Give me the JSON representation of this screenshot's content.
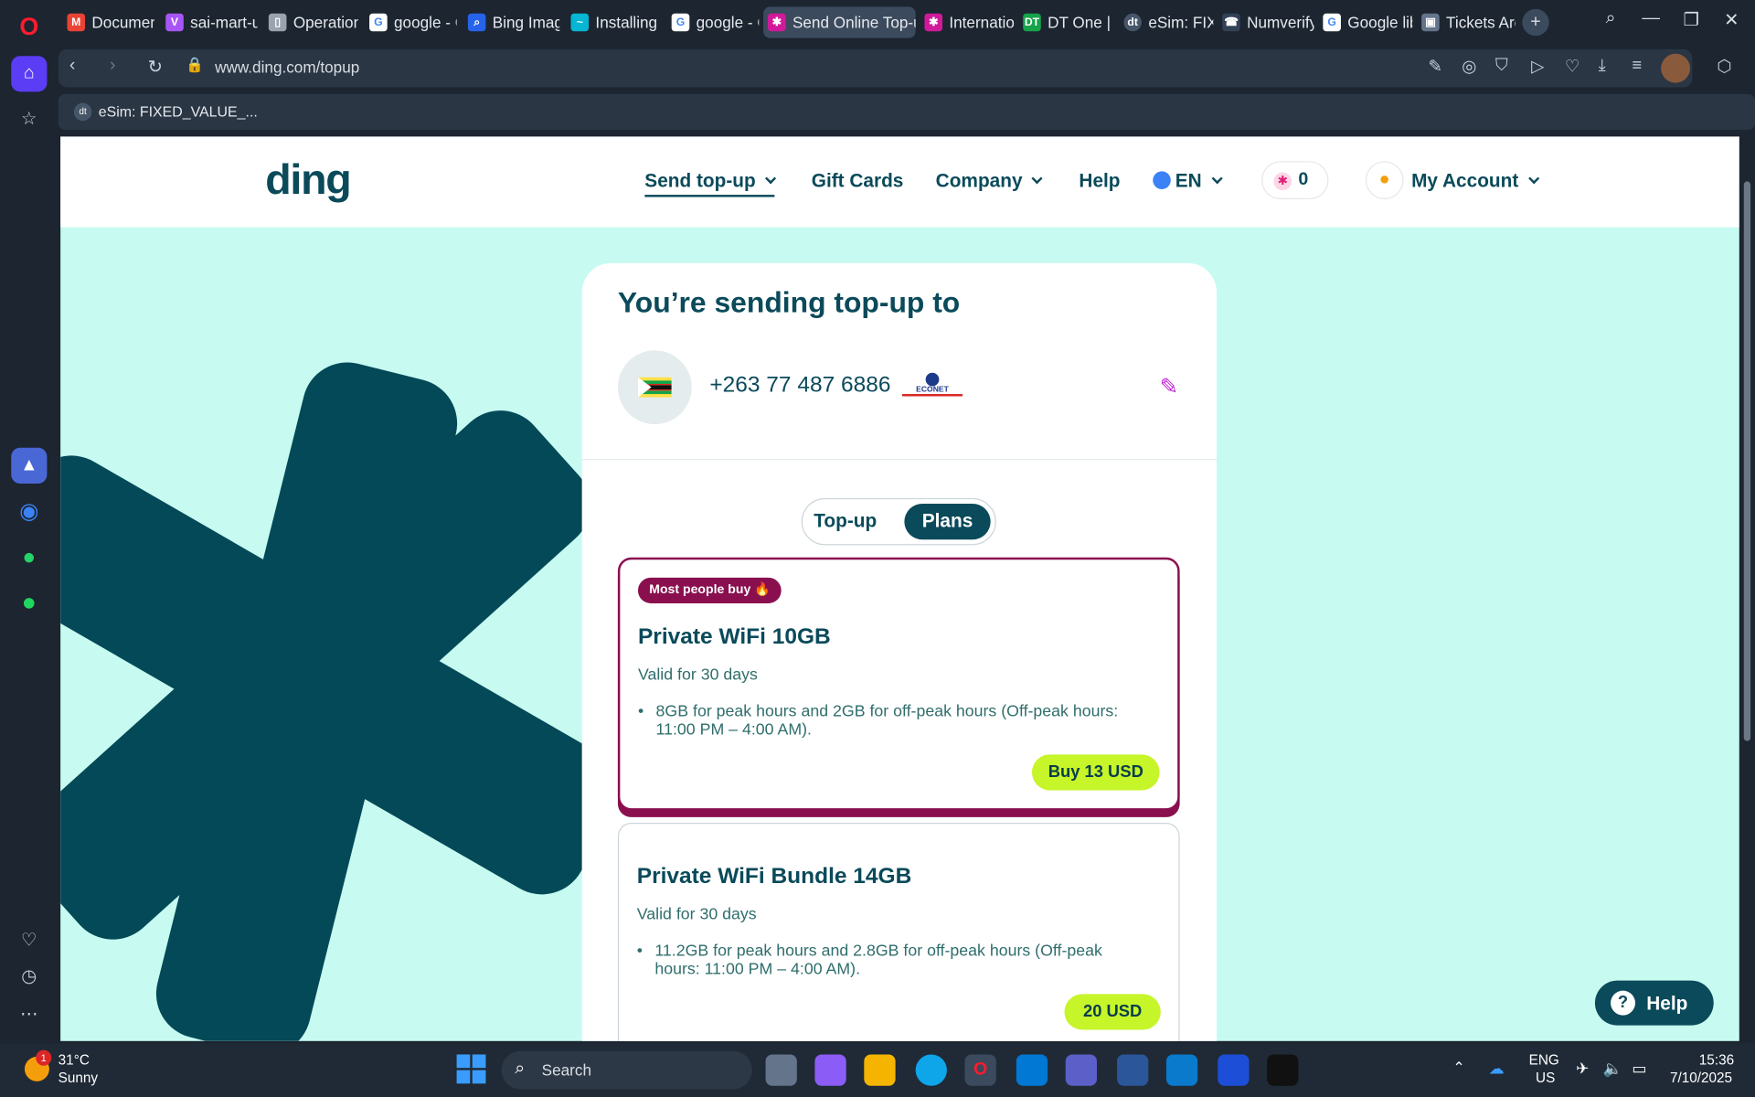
{
  "browser": {
    "tabs": [
      "Document",
      "sai-mart-ui",
      "Operationa",
      "google - G",
      "Bing Image",
      "Installing T",
      "google - G",
      "Send Online Top-up",
      "Internation",
      "DT One | M",
      "eSim: FIXED",
      "Numverify",
      "Google lib",
      "Tickets Arc"
    ],
    "url": "www.ding.com/topup",
    "bookmark": "eSim: FIXED_VALUE_..."
  },
  "site": {
    "logo": "ding",
    "nav": {
      "send_topup": "Send top-up",
      "gift_cards": "Gift Cards",
      "company": "Company",
      "help": "Help",
      "lang": "EN",
      "points": "0",
      "account": "My Account"
    }
  },
  "topup": {
    "heading": "You’re sending top-up to",
    "phone": "+263 77 487 6886",
    "operator": "ECONET",
    "toggle": {
      "topup": "Top-up",
      "plans": "Plans",
      "selected": "Plans"
    }
  },
  "plans": [
    {
      "badge": "Most people buy 🔥",
      "title": "Private WiFi 10GB",
      "validity": "Valid for 30 days",
      "bullet": "8GB for peak hours and 2GB for off-peak hours (Off-peak hours: 11:00 PM – 4:00 AM).",
      "button": "Buy 13 USD"
    },
    {
      "title": "Private WiFi Bundle 14GB",
      "validity": "Valid for 30 days",
      "bullet": "11.2GB for peak hours and 2.8GB for off-peak hours (Off-peak hours: 11:00 PM – 4:00 AM).",
      "button": "20 USD"
    }
  ],
  "help_button": "Help",
  "taskbar": {
    "weather_temp": "31°C",
    "weather_desc": "Sunny",
    "weather_badge": "1",
    "search": "Search",
    "lang1": "ENG",
    "lang2": "US",
    "time": "15:36",
    "date": "7/10/2025"
  },
  "colors": {
    "brand": "#0a4a5a",
    "accent_pink": "#8a0f4f",
    "buy_green": "#c6f52a",
    "bg_mint": "#c7fbf1"
  }
}
